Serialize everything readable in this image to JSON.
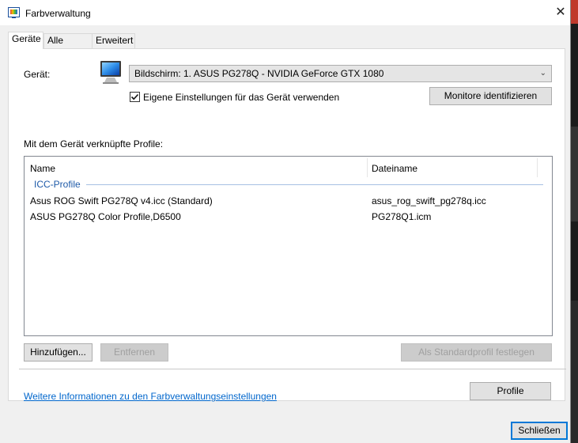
{
  "window": {
    "title": "Farbverwaltung",
    "close_glyph": "✕"
  },
  "tabs": [
    {
      "label": "Geräte",
      "active": true
    },
    {
      "label": "Alle Profile",
      "active": false
    },
    {
      "label": "Erweitert",
      "active": false
    }
  ],
  "device": {
    "label": "Gerät:",
    "selected": "Bildschirm: 1. ASUS PG278Q - NVIDIA GeForce GTX 1080",
    "checkbox_label": "Eigene Einstellungen für das Gerät verwenden",
    "checkbox_checked": true,
    "identify_button": "Monitore identifizieren",
    "icon": "monitor-icon"
  },
  "profiles": {
    "section_label": "Mit dem Gerät verknüpfte Profile:",
    "columns": [
      "Name",
      "Dateiname"
    ],
    "group": "ICC-Profile",
    "rows": [
      {
        "name": "Asus ROG Swift PG278Q v4.icc (Standard)",
        "file": "asus_rog_swift_pg278q.icc"
      },
      {
        "name": "ASUS PG278Q Color Profile,D6500",
        "file": "PG278Q1.icm"
      }
    ]
  },
  "buttons": {
    "add": "Hinzufügen...",
    "remove": "Entfernen",
    "set_default": "Als Standardprofil festlegen",
    "profile": "Profile",
    "close": "Schließen"
  },
  "footer": {
    "link": "Weitere Informationen zu den Farbverwaltungseinstellungen"
  },
  "colors": {
    "accent": "#0078d7",
    "link": "#0066cc",
    "group_text": "#1e5aa8"
  }
}
